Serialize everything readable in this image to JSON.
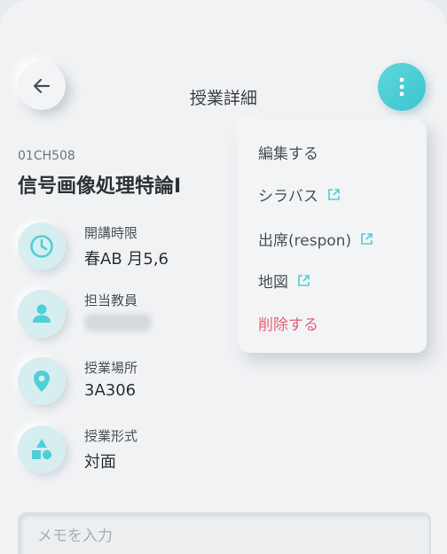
{
  "header": {
    "title": "授業詳細",
    "back_icon": "arrow-left-icon",
    "menu_icon": "more-vertical-icon"
  },
  "course": {
    "code": "01CH508",
    "name": "信号画像処理特論I"
  },
  "info": [
    {
      "icon": "clock-icon",
      "label": "開講時限",
      "value": "春AB 月5,6"
    },
    {
      "icon": "person-icon",
      "label": "担当教員",
      "value": ""
    },
    {
      "icon": "location-pin-icon",
      "label": "授業場所",
      "value": "3A306"
    },
    {
      "icon": "shapes-icon",
      "label": "授業形式",
      "value": "対面"
    }
  ],
  "menu": {
    "items": [
      {
        "label": "編集する",
        "external": false
      },
      {
        "label": "シラバス",
        "external": true
      },
      {
        "label": "出席(respon)",
        "external": true
      },
      {
        "label": "地図",
        "external": true
      },
      {
        "label": "削除する",
        "external": false,
        "danger": true
      }
    ]
  },
  "memo": {
    "placeholder": "メモを入力",
    "value": ""
  },
  "colors": {
    "accent": "#4fcfd6",
    "danger": "#e0647a",
    "background": "#f1f2f4"
  }
}
